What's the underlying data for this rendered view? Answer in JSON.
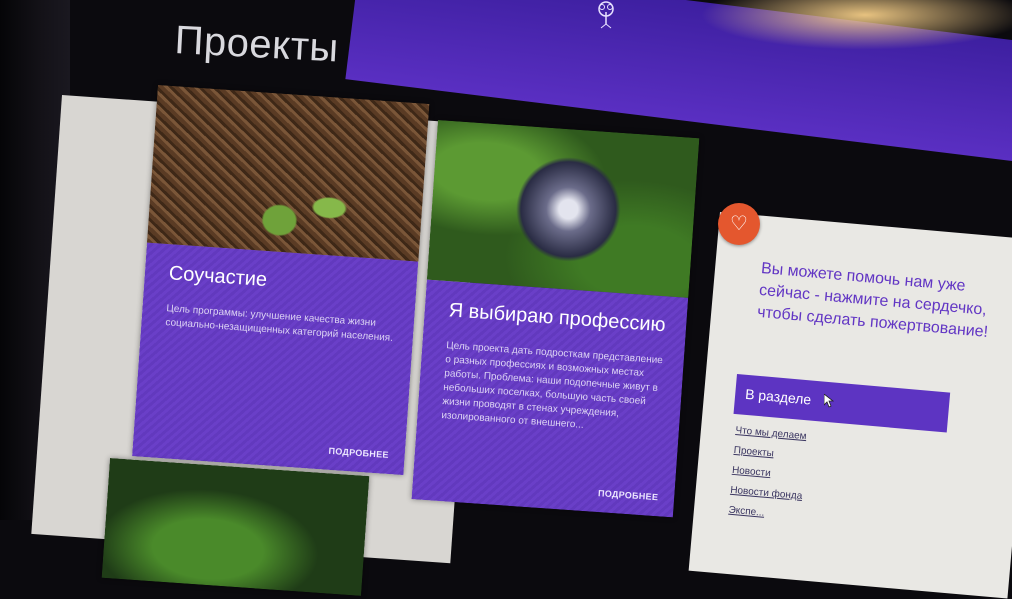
{
  "header": {
    "title": "Проекты"
  },
  "cards": [
    {
      "title": "Соучастие",
      "text": "Цель программы: улучшение качества жизни социально-незащищенных категорий населения.",
      "more": "ПОДРОБНЕЕ"
    },
    {
      "title": "Я выбираю профессию",
      "text": "Цель проекта дать подросткам представление о разных профессиях и возможных местах работы. Проблема: наши подопечные живут в небольших поселках, большую часть своей жизни проводят в стенах учреждения, изолированного от внешнего...",
      "more": "ПОДРОБНЕЕ"
    }
  ],
  "sidebar": {
    "donate_text": "Вы можете помочь нам уже сейчас - нажмите на сердечко, чтобы сделать пожертвование!",
    "section_title": "В разделе",
    "links": [
      "Что мы делаем",
      "Проекты",
      "Новости",
      "Новости фонда",
      "Экспе..."
    ]
  },
  "colors": {
    "accent": "#5d34c2",
    "heart": "#e4572e"
  }
}
